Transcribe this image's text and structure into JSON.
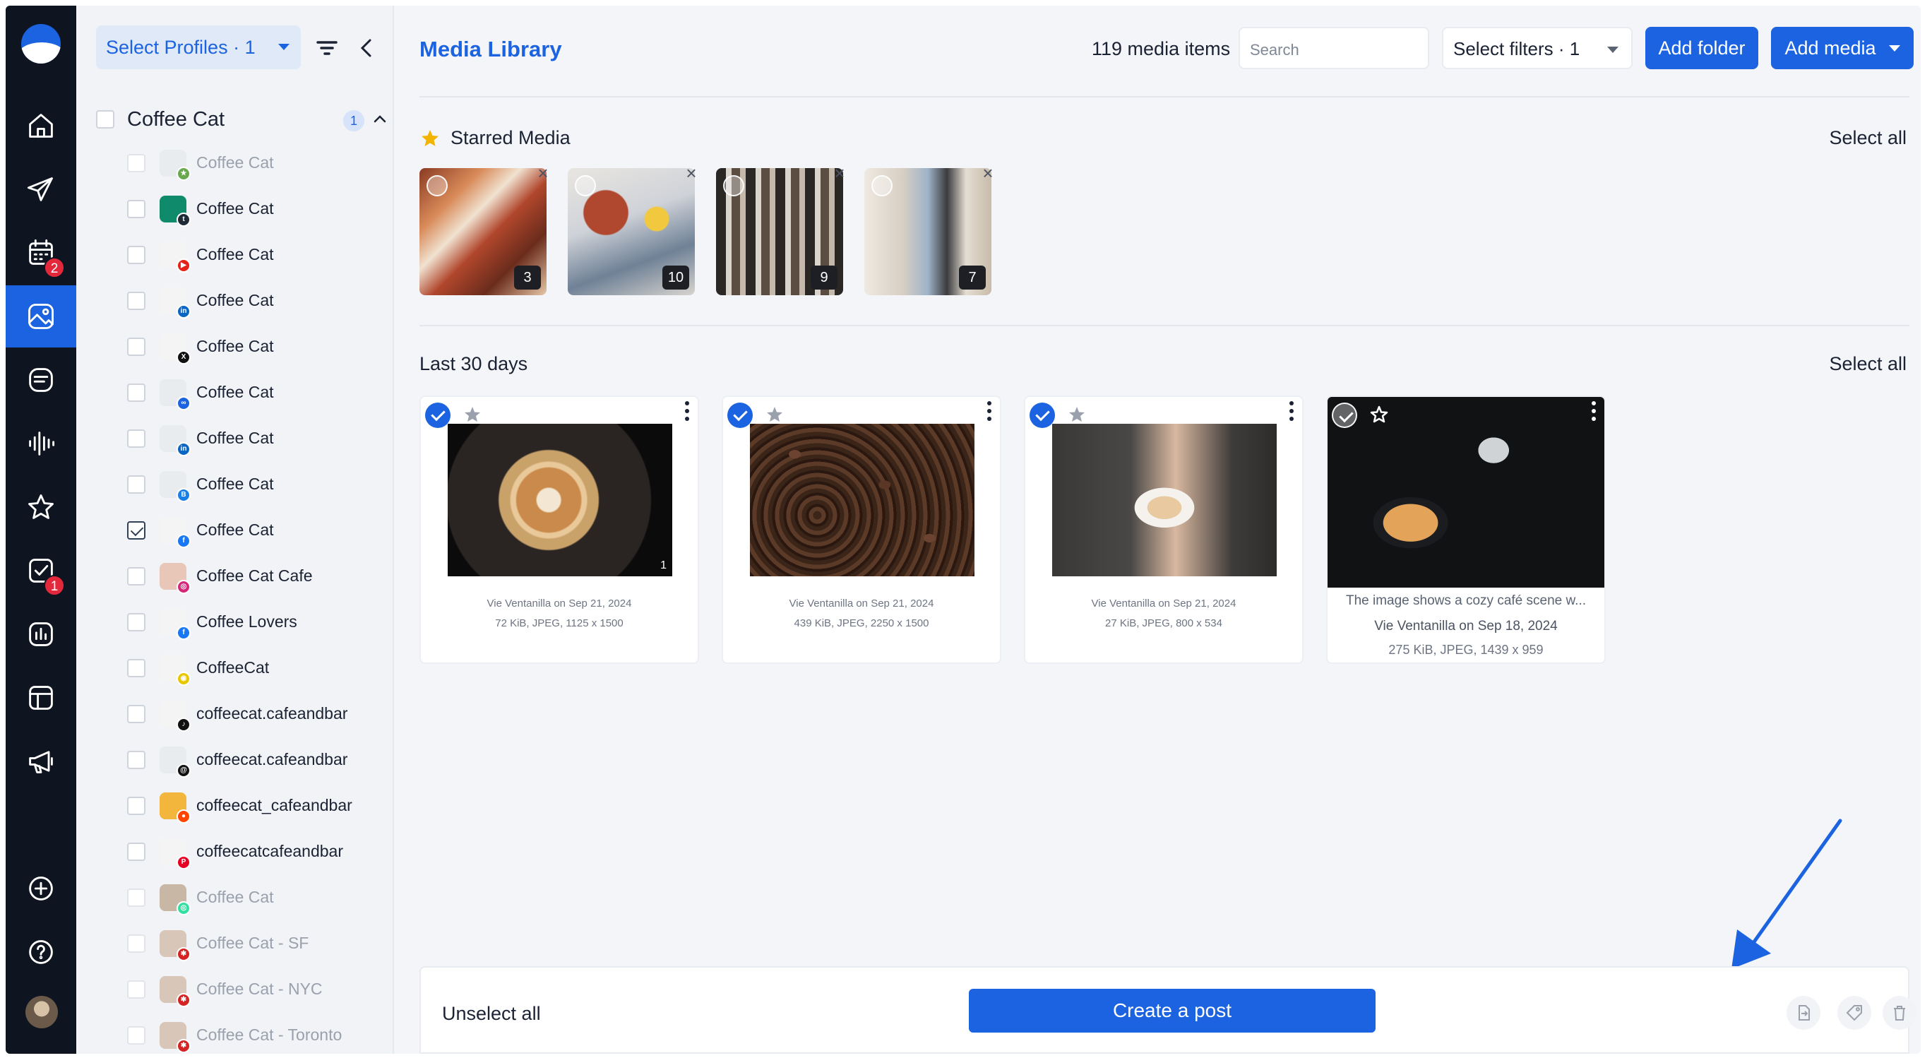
{
  "rail": {
    "badges": {
      "calendar": "2",
      "tasks": "1"
    }
  },
  "profiles": {
    "select_label": "Select Profiles · 1",
    "group": {
      "name": "Coffee Cat",
      "count": "1"
    },
    "items": [
      {
        "name": "Coffee Cat",
        "network": "google-business",
        "dim": true,
        "checked": false
      },
      {
        "name": "Coffee Cat",
        "network": "tumblr",
        "dim": false,
        "checked": false
      },
      {
        "name": "Coffee Cat",
        "network": "youtube",
        "dim": false,
        "checked": false
      },
      {
        "name": "Coffee Cat",
        "network": "linkedin",
        "dim": false,
        "checked": false
      },
      {
        "name": "Coffee Cat",
        "network": "x",
        "dim": false,
        "checked": false
      },
      {
        "name": "Coffee Cat",
        "network": "meta",
        "dim": false,
        "checked": false
      },
      {
        "name": "Coffee Cat",
        "network": "linkedin-page",
        "dim": false,
        "checked": false
      },
      {
        "name": "Coffee Cat",
        "network": "bluesky",
        "dim": false,
        "checked": false
      },
      {
        "name": "Coffee Cat",
        "network": "facebook",
        "dim": false,
        "checked": true
      },
      {
        "name": "Coffee Cat Cafe",
        "network": "instagram",
        "dim": false,
        "checked": false
      },
      {
        "name": "Coffee Lovers",
        "network": "facebook",
        "dim": false,
        "checked": false
      },
      {
        "name": "CoffeeCat",
        "network": "snapchat",
        "dim": false,
        "checked": false
      },
      {
        "name": "coffeecat.cafeandbar",
        "network": "tiktok",
        "dim": false,
        "checked": false
      },
      {
        "name": "coffeecat.cafeandbar",
        "network": "threads",
        "dim": false,
        "checked": false
      },
      {
        "name": "coffeecat_cafeandbar",
        "network": "reddit",
        "dim": false,
        "checked": false
      },
      {
        "name": "coffeecatcafeandbar",
        "network": "pinterest",
        "dim": false,
        "checked": false
      },
      {
        "name": "Coffee Cat",
        "network": "tripadvisor",
        "dim": true,
        "checked": false
      },
      {
        "name": "Coffee Cat - SF",
        "network": "yelp",
        "dim": true,
        "checked": false
      },
      {
        "name": "Coffee Cat - NYC",
        "network": "yelp",
        "dim": true,
        "checked": false
      },
      {
        "name": "Coffee Cat - Toronto",
        "network": "yelp",
        "dim": true,
        "checked": false
      }
    ]
  },
  "header": {
    "title": "Media Library",
    "media_count": "119 media items",
    "search_placeholder": "Search",
    "filters_label": "Select filters · 1",
    "add_folder": "Add folder",
    "add_media": "Add media"
  },
  "starred": {
    "title": "Starred Media",
    "select_all": "Select all",
    "items": [
      {
        "count": "3"
      },
      {
        "count": "10"
      },
      {
        "count": "9"
      },
      {
        "count": "7"
      }
    ]
  },
  "recent": {
    "title": "Last 30 days",
    "select_all": "Select all",
    "cards": [
      {
        "selected": true,
        "badge": "1",
        "byline": "Vie Ventanilla on Sep 21, 2024",
        "info": "72 KiB, JPEG, 1125 x 1500"
      },
      {
        "selected": true,
        "badge": "",
        "byline": "Vie Ventanilla on Sep 21, 2024",
        "info": "439 KiB, JPEG, 2250 x 1500"
      },
      {
        "selected": true,
        "badge": "",
        "byline": "Vie Ventanilla on Sep 21, 2024",
        "info": "27 KiB, JPEG, 800 x 534"
      },
      {
        "selected": false,
        "description": "The image shows a cozy café scene w...",
        "byline": "Vie Ventanilla on Sep 18, 2024",
        "info": "275 KiB, JPEG, 1439 x 959"
      }
    ]
  },
  "actionbar": {
    "unselect_all": "Unselect all",
    "create_post": "Create a post"
  },
  "colors": {
    "accent": "#1b63e0",
    "rail_bg": "#0e1420",
    "badge_red": "#e3283c",
    "star_yellow": "#f2b400"
  }
}
